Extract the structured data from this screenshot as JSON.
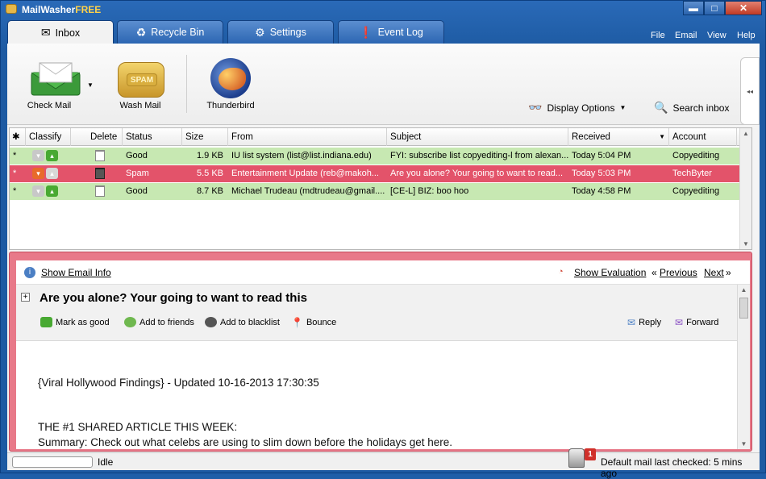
{
  "window": {
    "app_name": "MailWasher",
    "app_edition": "FREE",
    "minimize": "▬",
    "maximize": "□",
    "close": "✕"
  },
  "tabs": [
    {
      "label": "Inbox",
      "icon": "envelope-icon",
      "active": true
    },
    {
      "label": "Recycle Bin",
      "icon": "recycle-icon",
      "active": false
    },
    {
      "label": "Settings",
      "icon": "gear-icon",
      "active": false
    },
    {
      "label": "Event Log",
      "icon": "info-icon",
      "active": false
    }
  ],
  "menu": [
    "File",
    "Email",
    "View",
    "Help"
  ],
  "ribbon": {
    "check_mail": "Check Mail",
    "wash_mail": "Wash Mail",
    "spam_badge": "SPAM",
    "thunderbird": "Thunderbird",
    "display_options": "Display Options",
    "search_inbox": "Search inbox"
  },
  "email_list": {
    "columns": [
      "Classify",
      "Delete",
      "Status",
      "Size",
      "From",
      "Subject",
      "Received",
      "Account"
    ],
    "rows": [
      {
        "marker": "*",
        "status": "Good",
        "size": "1.9 KB",
        "from": "IU list system (list@list.indiana.edu)",
        "subject": "FYI: subscribe list copyediting-l from alexan...",
        "received": "Today 5:04 PM",
        "account": "Copyediting",
        "type": "good"
      },
      {
        "marker": "*",
        "status": "Spam",
        "size": "5.5 KB",
        "from": "Entertainment Update (reb@makoh...",
        "subject": "Are you alone? Your going to want to read...",
        "received": "Today 5:03 PM",
        "account": "TechByter",
        "type": "spam"
      },
      {
        "marker": "*",
        "status": "Good",
        "size": "8.7 KB",
        "from": "Michael Trudeau (mdtrudeau@gmail....",
        "subject": "[CE-L] BIZ: boo hoo",
        "received": "Today 4:58 PM",
        "account": "Copyediting",
        "type": "good"
      }
    ]
  },
  "preview": {
    "show_email_info": "Show Email Info",
    "show_evaluation": "Show Evaluation",
    "previous": "Previous",
    "next": "Next",
    "prev_arrow": "«",
    "next_arrow": "»",
    "expand": "+",
    "subject": "Are you alone? Your going to want to read this",
    "actions": {
      "mark_good": "Mark as good",
      "add_friends": "Add to friends",
      "add_blacklist": "Add to blacklist",
      "bounce": "Bounce",
      "reply": "Reply",
      "forward": "Forward"
    },
    "body": {
      "line1": "{Viral Hollywood Findings} - Updated 10-16-2013 17:30:35",
      "line2": "THE #1 SHARED ARTICLE THIS WEEK:",
      "line3": "Summary: Check out what celebs are using to slim down before the holidays get here."
    }
  },
  "status_bar": {
    "progress": 0,
    "state": "Idle",
    "badge_count": "1",
    "last_checked": "Default mail last checked: 5 mins ago"
  },
  "colors": {
    "good_row": "#c7e8b2",
    "spam_row": "#e3536a",
    "accent": "#1f5ea8"
  }
}
